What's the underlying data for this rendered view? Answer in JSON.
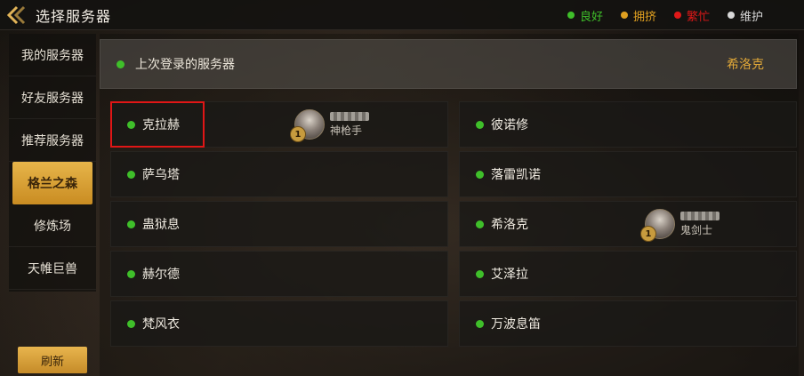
{
  "header": {
    "title": "选择服务器",
    "legend": [
      {
        "label": "良好",
        "color": "#3fbf2a"
      },
      {
        "label": "拥挤",
        "color": "#e0a020"
      },
      {
        "label": "繁忙",
        "color": "#e01818"
      },
      {
        "label": "维护",
        "color": "#d8d8d8"
      }
    ]
  },
  "sidebar": {
    "items": [
      {
        "label": "我的服务器",
        "active": false
      },
      {
        "label": "好友服务器",
        "active": false
      },
      {
        "label": "推荐服务器",
        "active": false
      },
      {
        "label": "格兰之森",
        "active": true
      },
      {
        "label": "修炼场",
        "active": false
      },
      {
        "label": "天帷巨兽",
        "active": false
      }
    ],
    "refresh_label": "刷新"
  },
  "last_login": {
    "label": "上次登录的服务器",
    "server": "希洛克",
    "status_color": "#3fbf2a"
  },
  "servers": [
    {
      "name": "克拉赫",
      "status": "良好",
      "highlighted": true,
      "character": {
        "level": "1",
        "class": "神枪手"
      }
    },
    {
      "name": "彼诺修",
      "status": "良好"
    },
    {
      "name": "萨乌塔",
      "status": "良好"
    },
    {
      "name": "落雷凯诺",
      "status": "良好"
    },
    {
      "name": "蛊狱息",
      "status": "良好"
    },
    {
      "name": "希洛克",
      "status": "良好",
      "character": {
        "level": "1",
        "class": "鬼剑士"
      }
    },
    {
      "name": "赫尔德",
      "status": "良好"
    },
    {
      "name": "艾泽拉",
      "status": "良好"
    },
    {
      "name": "梵风衣",
      "status": "良好"
    },
    {
      "name": "万波息笛",
      "status": "良好"
    }
  ],
  "colors": {
    "accent_gold": "#e0a838",
    "status_good": "#3fbf2a",
    "highlight_red": "#e01616"
  }
}
